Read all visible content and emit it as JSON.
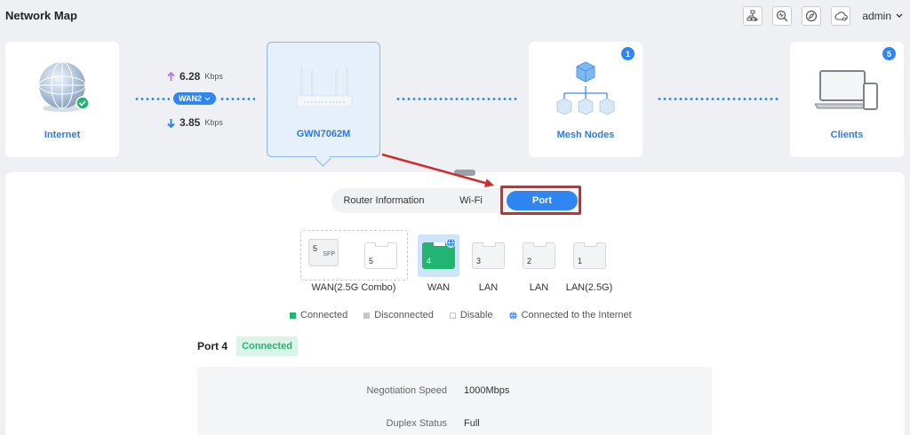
{
  "page": {
    "title": "Network Map"
  },
  "toolbar": {
    "icons": [
      "topology-add-icon",
      "diagnose-icon",
      "compass-icon",
      "cloud-settings-icon"
    ],
    "user": "admin"
  },
  "map": {
    "internet": {
      "label": "Internet"
    },
    "uplink": {
      "upload_value": "6.28",
      "upload_unit": "Kbps",
      "download_value": "3.85",
      "download_unit": "Kbps",
      "wan_label": "WAN2"
    },
    "router": {
      "label": "GWN7062M"
    },
    "mesh": {
      "label": "Mesh Nodes",
      "count": "1"
    },
    "clients": {
      "label": "Clients",
      "count": "5"
    }
  },
  "tabs": {
    "router_info": "Router Information",
    "wifi": "Wi-Fi",
    "port": "Port",
    "active": "Port"
  },
  "ports": {
    "sfp": {
      "number": "5",
      "tag": "SFP"
    },
    "port5": {
      "number": "5"
    },
    "port4": {
      "number": "4"
    },
    "port3": {
      "number": "3"
    },
    "port2": {
      "number": "2"
    },
    "port1": {
      "number": "1"
    },
    "labels": {
      "combo": "WAN(2.5G Combo)",
      "wan": "WAN",
      "lan3": "LAN",
      "lan2": "LAN",
      "lan1": "LAN(2.5G)"
    }
  },
  "legend": {
    "connected": "Connected",
    "disconnected": "Disconnected",
    "disable": "Disable",
    "internet": "Connected to the Internet"
  },
  "detail": {
    "port_title": "Port 4",
    "status": "Connected",
    "rows": [
      {
        "key": "Negotiation Speed",
        "value": "1000Mbps"
      },
      {
        "key": "Duplex Status",
        "value": "Full"
      }
    ]
  },
  "colors": {
    "accent": "#2f86f3",
    "connected": "#22b473",
    "disconnected": "#c5c8cd",
    "annotation": "#d32a2a"
  }
}
